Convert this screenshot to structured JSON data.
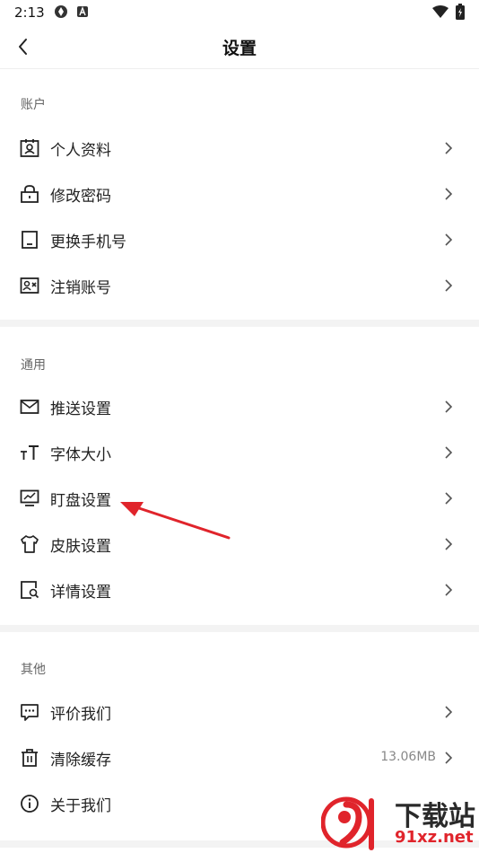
{
  "status_bar": {
    "time": "2:13"
  },
  "header": {
    "title": "设置"
  },
  "sections": [
    {
      "title": "账户",
      "items": [
        {
          "label": "个人资料"
        },
        {
          "label": "修改密码"
        },
        {
          "label": "更换手机号"
        },
        {
          "label": "注销账号"
        }
      ]
    },
    {
      "title": "通用",
      "items": [
        {
          "label": "推送设置"
        },
        {
          "label": "字体大小"
        },
        {
          "label": "盯盘设置"
        },
        {
          "label": "皮肤设置"
        },
        {
          "label": "详情设置"
        }
      ]
    },
    {
      "title": "其他",
      "items": [
        {
          "label": "评价我们"
        },
        {
          "label": "清除缓存",
          "value": "13.06MB"
        },
        {
          "label": "关于我们"
        }
      ]
    }
  ],
  "watermark": {
    "text": "下载站",
    "url": "91xz.net"
  },
  "colors": {
    "arrow": "#e0242b",
    "divider": "#f3f3f3"
  }
}
